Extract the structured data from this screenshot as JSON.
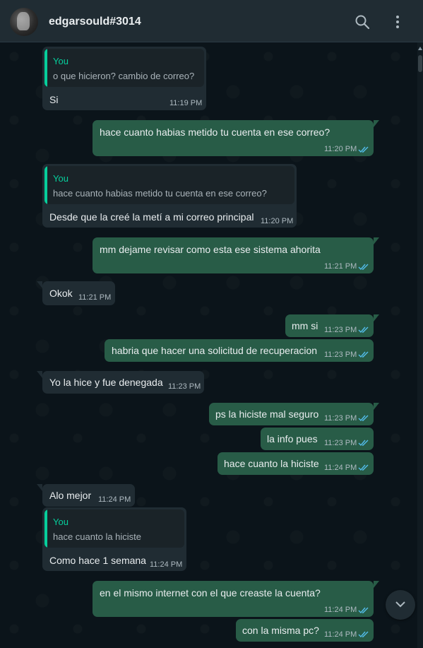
{
  "header": {
    "title": "edgarsould#3014",
    "avatar_icon": "user-avatar",
    "search_icon": "search-icon",
    "menu_icon": "more-vertical-icon"
  },
  "colors": {
    "header_bg": "#202c33",
    "chat_bg": "#0b141a",
    "incoming_bubble": "#202c33",
    "outgoing_bubble": "#285c47",
    "quote_accent": "#06cf9c",
    "read_ticks": "#53bdeb"
  },
  "messages": [
    {
      "dir": "in",
      "quote_author": "You",
      "quote_text": "o que hicieron? cambio de correo?",
      "text": "Si",
      "time": "11:19 PM"
    },
    {
      "dir": "out",
      "text": "hace cuanto habias metido tu cuenta en ese correo?",
      "time": "11:20 PM",
      "status": "read"
    },
    {
      "dir": "in",
      "quote_author": "You",
      "quote_text": "hace cuanto habias metido tu cuenta en ese correo?",
      "text": "Desde que la creé la metí a mi correo principal",
      "time": "11:20 PM"
    },
    {
      "dir": "out",
      "text": "mm dejame revisar como esta ese sistema ahorita",
      "time": "11:21 PM",
      "status": "read"
    },
    {
      "dir": "in",
      "text": "Okok",
      "time": "11:21 PM"
    },
    {
      "dir": "out",
      "text": "mm si",
      "time": "11:23 PM",
      "status": "read"
    },
    {
      "dir": "out",
      "text": "habria que hacer una solicitud de recuperacion",
      "time": "11:23 PM",
      "status": "read"
    },
    {
      "dir": "in",
      "text": "Yo la hice y fue denegada",
      "time": "11:23 PM"
    },
    {
      "dir": "out",
      "text": "ps la hiciste mal seguro",
      "time": "11:23 PM",
      "status": "read"
    },
    {
      "dir": "out",
      "text": "la info pues",
      "time": "11:23 PM",
      "status": "read"
    },
    {
      "dir": "out",
      "text": "hace cuanto la hiciste",
      "time": "11:24 PM",
      "status": "read"
    },
    {
      "dir": "in",
      "text": "Alo mejor",
      "time": "11:24 PM"
    },
    {
      "dir": "in",
      "quote_author": "You",
      "quote_text": "hace cuanto la hiciste",
      "text": "Como hace 1 semana",
      "time": "11:24 PM"
    },
    {
      "dir": "out",
      "text": "en el mismo internet con el que creaste la cuenta?",
      "time": "11:24 PM",
      "status": "read"
    },
    {
      "dir": "out",
      "text": "con la misma pc?",
      "time": "11:24 PM",
      "status": "read"
    }
  ],
  "scroll_down_icon": "chevron-down-icon"
}
